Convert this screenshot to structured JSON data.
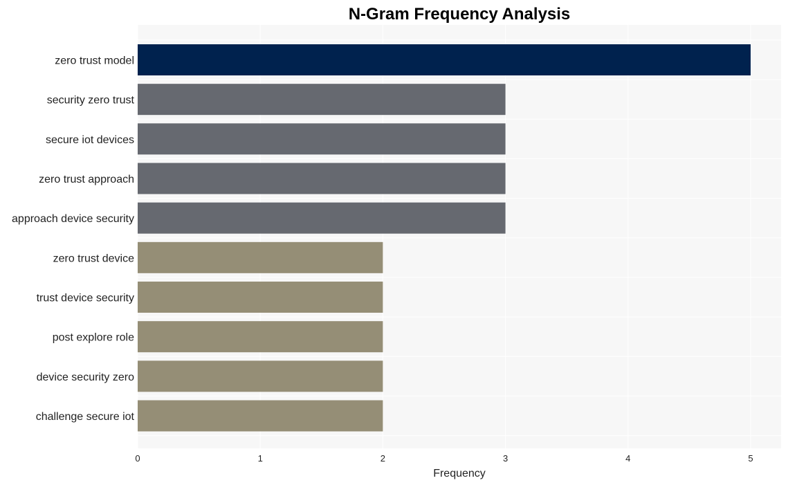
{
  "chart_data": {
    "type": "bar",
    "orientation": "horizontal",
    "title": "N-Gram Frequency Analysis",
    "xlabel": "Frequency",
    "ylabel": "",
    "xlim": [
      0,
      5.25
    ],
    "xticks": [
      0,
      1,
      2,
      3,
      4,
      5
    ],
    "grid": true,
    "categories": [
      "zero trust model",
      "security zero trust",
      "secure iot devices",
      "zero trust approach",
      "approach device security",
      "zero trust device",
      "trust device security",
      "post explore role",
      "device security zero",
      "challenge secure iot"
    ],
    "values": [
      5,
      3,
      3,
      3,
      3,
      2,
      2,
      2,
      2,
      2
    ],
    "colors": [
      "#00224e",
      "#666970",
      "#666970",
      "#666970",
      "#666970",
      "#958e76",
      "#958e76",
      "#958e76",
      "#958e76",
      "#958e76"
    ],
    "plot_background": "#f7f7f7"
  }
}
